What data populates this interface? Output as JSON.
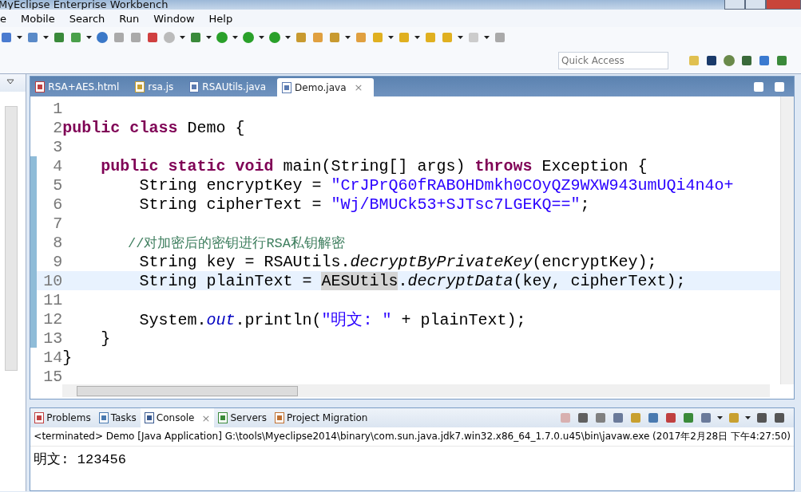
{
  "window": {
    "title": "MyEclipse Enterprise Workbench"
  },
  "menu": [
    "e",
    "Mobile",
    "Search",
    "Run",
    "Window",
    "Help"
  ],
  "quick_access": {
    "placeholder": "Quick Access"
  },
  "editor": {
    "tabs": [
      {
        "label": "RSA+AES.html",
        "kind": "html",
        "selected": false
      },
      {
        "label": "rsa.js",
        "kind": "js",
        "selected": false
      },
      {
        "label": "RSAUtils.java",
        "kind": "java",
        "selected": false
      },
      {
        "label": "Demo.java",
        "kind": "java",
        "selected": true,
        "close": "×"
      }
    ],
    "lines": [
      {
        "number": "1",
        "changed": false,
        "current": false
      },
      {
        "number": "2",
        "changed": false,
        "current": false,
        "tokens": [
          {
            "kind": "kw",
            "text": "public class"
          },
          {
            "kind": "plain",
            "text": " Demo {"
          }
        ]
      },
      {
        "number": "3",
        "changed": false,
        "current": false
      },
      {
        "number": "4",
        "changed": true,
        "current": false,
        "tokens": [
          {
            "kind": "kw",
            "text": "    public static void"
          },
          {
            "kind": "plain",
            "text": " main(String[] args) "
          },
          {
            "kind": "kw",
            "text": "throws"
          },
          {
            "kind": "plain",
            "text": " Exception {"
          }
        ]
      },
      {
        "number": "5",
        "changed": true,
        "current": false,
        "tokens": [
          {
            "kind": "plain",
            "text": "        String encryptKey = "
          },
          {
            "kind": "str",
            "text": "\"CrJPrQ60fRABOHDmkh0COyQZ9WXW943umUQi4n4o+"
          }
        ]
      },
      {
        "number": "6",
        "changed": true,
        "current": false,
        "tokens": [
          {
            "kind": "plain",
            "text": "        String cipherText = "
          },
          {
            "kind": "str",
            "text": "\"Wj/BMUCk53+SJTsc7LGEKQ==\""
          },
          {
            "kind": "plain",
            "text": ";"
          }
        ]
      },
      {
        "number": "7",
        "changed": true,
        "current": false
      },
      {
        "number": "8",
        "changed": true,
        "current": false,
        "tokens": [
          {
            "kind": "comment",
            "text": "        //对加密后的密钥进行RSA私钥解密"
          }
        ]
      },
      {
        "number": "9",
        "changed": true,
        "current": false,
        "tokens": [
          {
            "kind": "plain",
            "text": "        String key = RSAUtils."
          },
          {
            "kind": "static_method",
            "text": "decryptByPrivateKey"
          },
          {
            "kind": "plain",
            "text": "(encryptKey);"
          }
        ]
      },
      {
        "number": "10",
        "changed": true,
        "current": true,
        "tokens": [
          {
            "kind": "plain",
            "text": "        String plainText = "
          },
          {
            "kind": "occurrence",
            "text": "AESUtils"
          },
          {
            "kind": "plain",
            "text": "."
          },
          {
            "kind": "static_method",
            "text": "decryptData"
          },
          {
            "kind": "plain",
            "text": "(key, cipherText);"
          }
        ]
      },
      {
        "number": "11",
        "changed": true,
        "current": false
      },
      {
        "number": "12",
        "changed": true,
        "current": false,
        "tokens": [
          {
            "kind": "plain",
            "text": "        System."
          },
          {
            "kind": "static_field",
            "text": "out"
          },
          {
            "kind": "plain",
            "text": ".println("
          },
          {
            "kind": "str",
            "text": "\"明文: \""
          },
          {
            "kind": "plain",
            "text": " + plainText);"
          }
        ]
      },
      {
        "number": "13",
        "changed": true,
        "current": false,
        "tokens": [
          {
            "kind": "plain",
            "text": "    }"
          }
        ]
      },
      {
        "number": "14",
        "changed": false,
        "current": false,
        "tokens": [
          {
            "kind": "plain",
            "text": "}"
          }
        ]
      },
      {
        "number": "15",
        "changed": false,
        "current": false
      }
    ]
  },
  "console": {
    "tabs": [
      {
        "label": "Problems",
        "kind": "problems",
        "selected": false
      },
      {
        "label": "Tasks",
        "kind": "tasks",
        "selected": false
      },
      {
        "label": "Console",
        "kind": "console",
        "selected": true,
        "close": "×"
      },
      {
        "label": "Servers",
        "kind": "servers",
        "selected": false
      },
      {
        "label": "Project Migration",
        "kind": "migration",
        "selected": false
      }
    ],
    "header": "<terminated> Demo [Java Application] G:\\tools\\Myeclipse2014\\binary\\com.sun.java.jdk7.win32.x86_64_1.7.0.u45\\bin\\javaw.exe (2017年2月28日 下午4:27:50)",
    "output": "明文: 123456"
  }
}
